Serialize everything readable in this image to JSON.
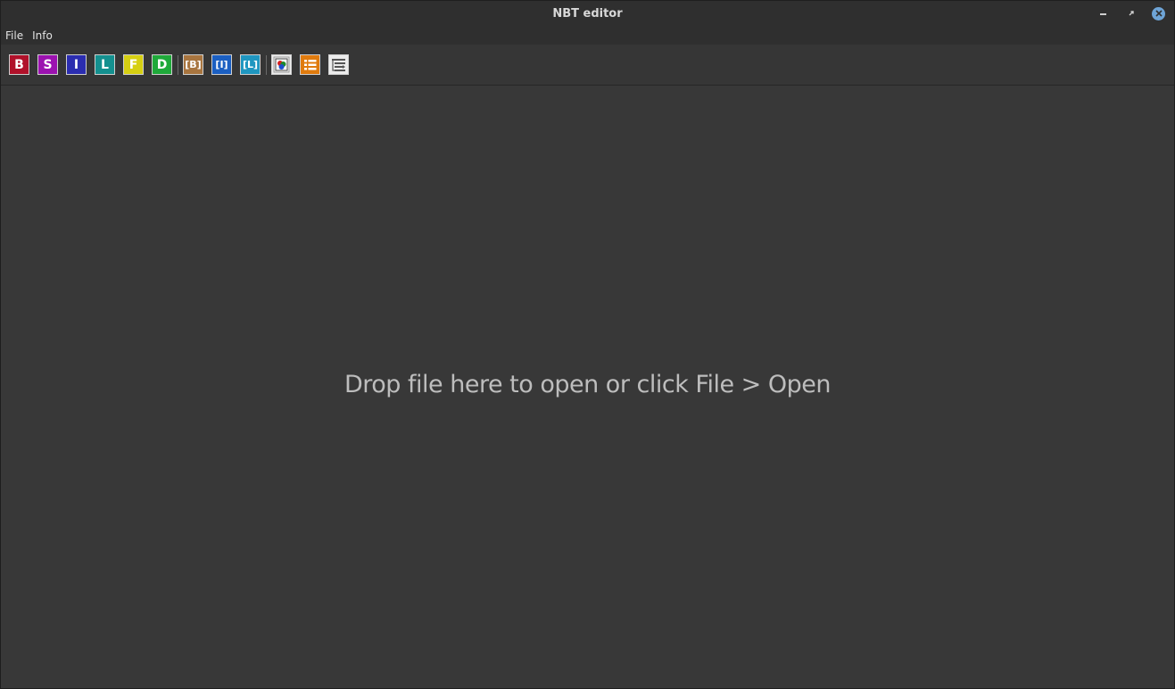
{
  "window": {
    "title": "NBT editor"
  },
  "menubar": {
    "items": [
      {
        "label": "File"
      },
      {
        "label": "Info"
      }
    ]
  },
  "toolbar": {
    "tag_buttons": [
      {
        "label": "B",
        "name": "add-byte-tag",
        "color": "#b0112a"
      },
      {
        "label": "S",
        "name": "add-short-tag",
        "color": "#9c12b0"
      },
      {
        "label": "I",
        "name": "add-int-tag",
        "color": "#2b2db0"
      },
      {
        "label": "L",
        "name": "add-long-tag",
        "color": "#14908f"
      },
      {
        "label": "F",
        "name": "add-float-tag",
        "color": "#d6cf12"
      },
      {
        "label": "D",
        "name": "add-double-tag",
        "color": "#1fa93a"
      }
    ],
    "array_buttons": [
      {
        "label": "[B]",
        "name": "add-byte-array-tag",
        "color": "#a8753f"
      },
      {
        "label": "[I]",
        "name": "add-int-array-tag",
        "color": "#1b5fc2"
      },
      {
        "label": "[L]",
        "name": "add-long-array-tag",
        "color": "#1f96c0"
      }
    ],
    "other_buttons": [
      {
        "name": "add-string-tag",
        "icon": "string-palette-icon"
      },
      {
        "name": "add-list-tag",
        "icon": "list-icon",
        "color": "#e07b0e"
      },
      {
        "name": "add-compound-tag",
        "icon": "compound-icon"
      }
    ]
  },
  "main": {
    "drop_hint": "Drop file here to open or click File > Open"
  }
}
